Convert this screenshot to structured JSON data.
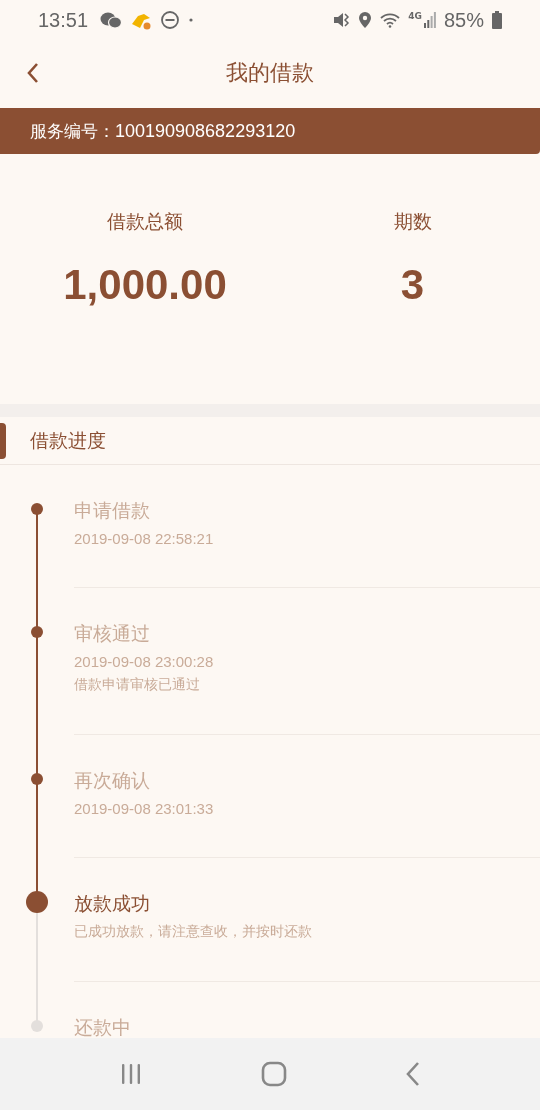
{
  "status_bar": {
    "time": "13:51",
    "battery": "85%",
    "network": "4G"
  },
  "header": {
    "title": "我的借款"
  },
  "service": {
    "label": "服务编号：",
    "number": "100190908682293120"
  },
  "summary": [
    {
      "label": "借款总额",
      "value": "1,000.00"
    },
    {
      "label": "期数",
      "value": "3"
    }
  ],
  "progress": {
    "title": "借款进度",
    "steps": [
      {
        "title": "申请借款",
        "time": "2019-09-08 22:58:21",
        "done": true,
        "current": false
      },
      {
        "title": "审核通过",
        "time": "2019-09-08 23:00:28",
        "note": "借款申请审核已通过",
        "done": true,
        "current": false
      },
      {
        "title": "再次确认",
        "time": "2019-09-08 23:01:33",
        "done": true,
        "current": false
      },
      {
        "title": "放款成功",
        "note": "已成功放款，请注意查收，并按时还款",
        "done": true,
        "current": true
      },
      {
        "title": "还款中",
        "done": false,
        "current": false
      }
    ]
  }
}
